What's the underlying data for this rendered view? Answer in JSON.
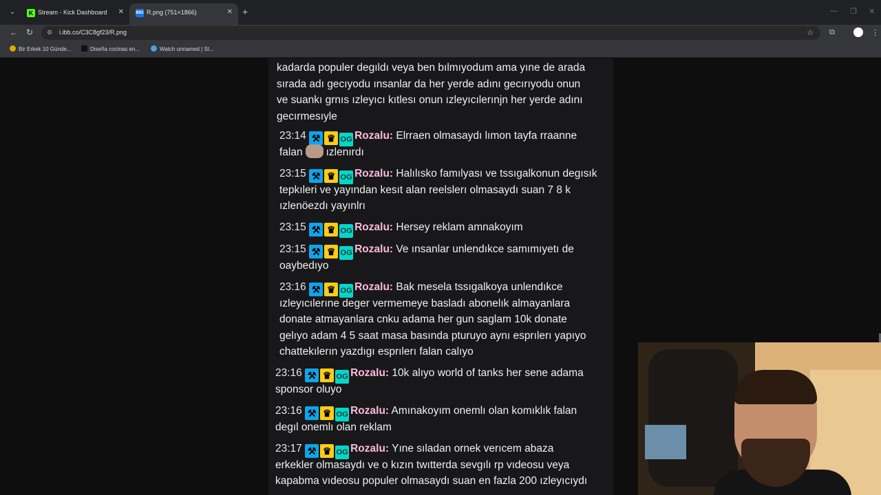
{
  "tabs": [
    {
      "title": "Stream - Kick Dashboard",
      "favicon": "K"
    },
    {
      "title": "R.png (751×1866)",
      "favicon": "img"
    }
  ],
  "browser": {
    "url": "i.ibb.co/C3C8gf23/R.png",
    "site_icon": "site-info-icon"
  },
  "bookmarks": [
    {
      "label": "Bir Erkek 10 Günde..."
    },
    {
      "label": "Diseña cocinas en..."
    },
    {
      "label": "Watch unnamed | St..."
    }
  ],
  "chat": {
    "intro_lines": [
      "kadarda populer degıldı veya ben bılmıyodum ama yıne de arada",
      "sırada adı gecıyodu ınsanlar da her yerde adını gecırıyodu onun",
      "ve suankı grnıs ızleyıcı kıtlesı onun ızleyıcılerınjn her yerde adını",
      "gecırmesıyle"
    ],
    "username": "Rozalu:",
    "messages": [
      {
        "time": "23:14",
        "lines": [
          "Elrraen olmasaydı lımon tayfa rraanne",
          "falan",
          "ızlenırdı"
        ]
      },
      {
        "time": "23:15",
        "lines": [
          "Halılısko famılyası ve tssıgalkonun degısık",
          "tepkıleri ve yayından kesıt alan reelslerı olmasaydı suan 7 8 k",
          "ızlenöezdı yayınlrı"
        ]
      },
      {
        "time": "23:15",
        "lines": [
          "Hersey reklam amnakoyım"
        ]
      },
      {
        "time": "23:15",
        "lines": [
          "Ve ınsanlar unlendıkce samımıyetı de",
          "oaybedıyo"
        ]
      },
      {
        "time": "23:16",
        "lines": [
          "Bak mesela tssıgalkoya unlendıkce",
          "ızleyıcılerıne deger vermemeye basladı abonelık almayanlara",
          "donate atmayanlara cnku adama her gun saglam 10k donate",
          "gelıyo adam 4 5 saat masa basında pturuyo aynı esprılerı yapıyo",
          "chattekılerın yazdıgı esprılerı falan calıyo"
        ]
      },
      {
        "time": "23:16",
        "lines": [
          "10k alıyo world of tanks her sene adama",
          "sponsor oluyo"
        ]
      },
      {
        "time": "23:16",
        "lines": [
          "Amınakoyım onemlı olan komıklık falan",
          "degıl onemlı olan reklam"
        ]
      },
      {
        "time": "23:17",
        "lines": [
          "Yıne sıladan ornek verıcem abaza",
          "erkekler olmasaydı ve o kızın twıtterda sevgılı rp vıdeosu veya",
          "kapabma vıdeosu populer olmasaydı suan en fazla 200 ızleyıcıydı"
        ]
      }
    ]
  },
  "colors": {
    "username": "#ffbadb",
    "badge_mod": "#0ea5e9",
    "badge_crown": "#facc15",
    "badge_og": "#06d6c8"
  }
}
